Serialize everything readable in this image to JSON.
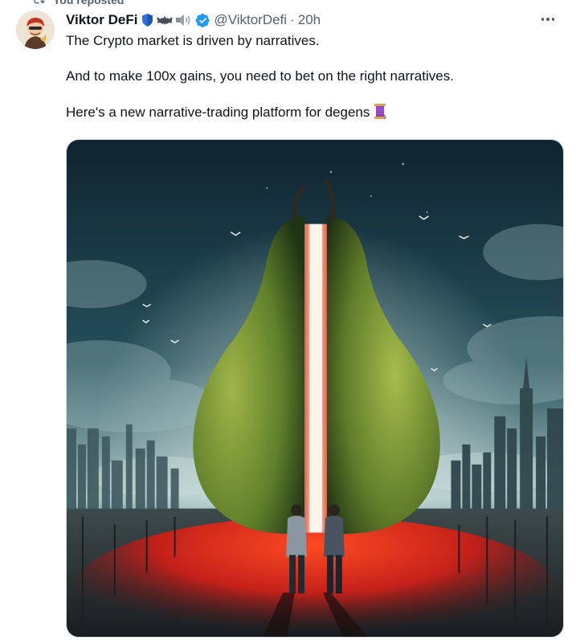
{
  "repost": {
    "label": "You reposted"
  },
  "author": {
    "name": "Viktor DeFi",
    "handle": "@ViktorDefi",
    "separator": "·",
    "time": "20h"
  },
  "tweet": {
    "line1": "The Crypto market is driven by narratives.",
    "line2": "And to make 100x gains, you need to bet on the right narratives.",
    "line3": "Here's a new narrative-trading platform for degens"
  },
  "icons": {
    "repost": "repost-icon",
    "verified": "verified-badge-icon",
    "more": "more-options-icon",
    "spool": "spool-of-thread-emoji"
  },
  "colors": {
    "verified": "#1d9bf0",
    "text": "#0f1419",
    "secondary": "#536471"
  }
}
